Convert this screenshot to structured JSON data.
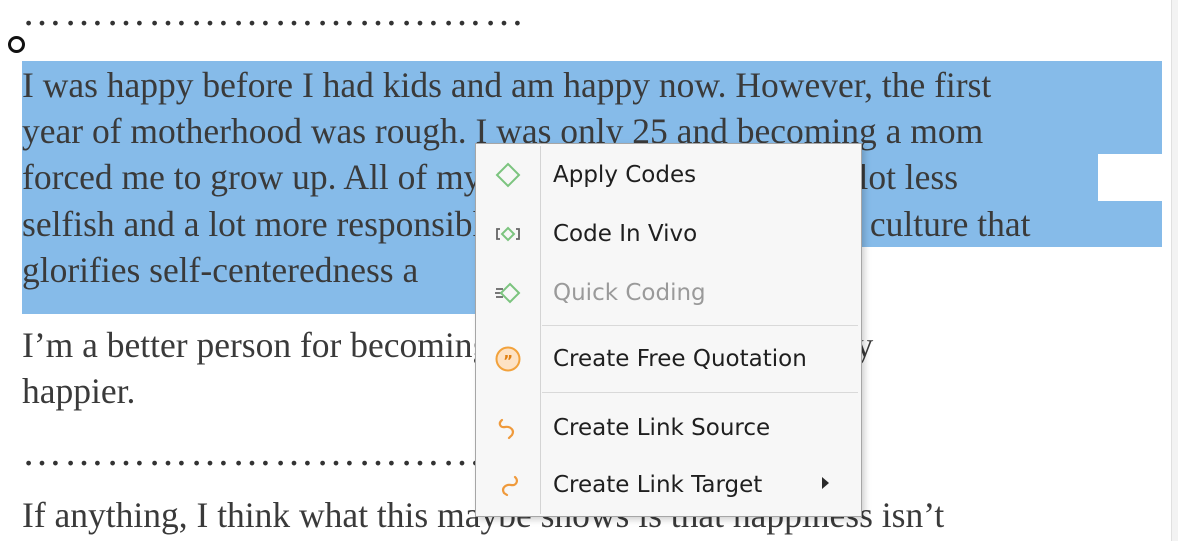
{
  "document": {
    "dotted_separator": "………………………………",
    "paragraph1_lines": [
      "I was happy before I had kids and am happy now. However, the first",
      "year of motherhood was rough. I was only 25 and becoming a mom",
      "forced me to grow up. All of my friends say I've become a lot less",
      "selfish and a lot more responsible, which is hard to say in a culture that",
      "glorifies self-centeredness a"
    ],
    "paragraph2_lines": [
      "I’m a better person for becoming a mother, but I am not any",
      "happier."
    ],
    "paragraph3_line": "If anything, I think what this maybe shows is that happiness isn’t"
  },
  "context_menu": {
    "items": [
      {
        "label": "Apply Codes",
        "icon": "apply-codes-icon",
        "enabled": true
      },
      {
        "label": "Code In Vivo",
        "icon": "code-in-vivo-icon",
        "enabled": true
      },
      {
        "label": "Quick Coding",
        "icon": "quick-coding-icon",
        "enabled": false
      },
      {
        "label": "Create Free Quotation",
        "icon": "free-quotation-icon",
        "enabled": true
      },
      {
        "label": "Create Link Source",
        "icon": "link-source-icon",
        "enabled": true
      },
      {
        "label": "Create Link Target",
        "icon": "link-target-icon",
        "enabled": true,
        "has_submenu": true
      }
    ]
  },
  "colors": {
    "selection": "#86bbe9",
    "code_green": "#7cc47f",
    "quotation_orange": "#f2a23c",
    "link_orange": "#ef9a3c"
  }
}
